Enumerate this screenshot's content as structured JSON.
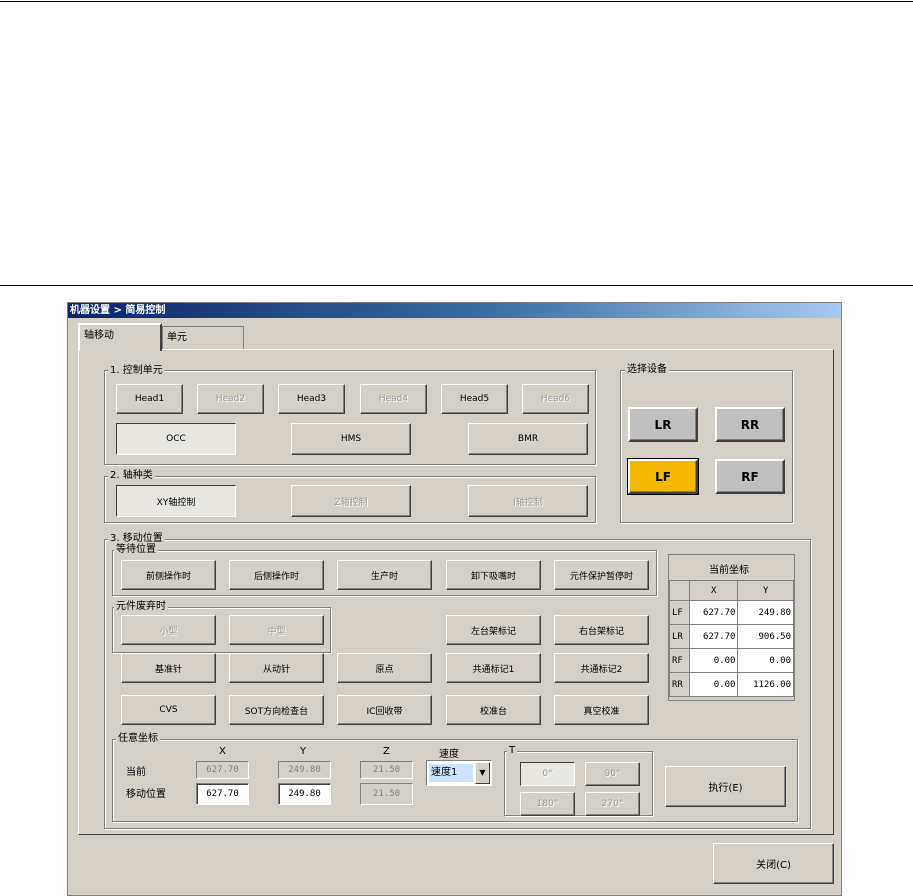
{
  "window": {
    "title": "机器设置 > 简易控制"
  },
  "tabs": [
    {
      "label": "轴移动"
    },
    {
      "label": "单元"
    }
  ],
  "control_unit": {
    "title": "1. 控制单元",
    "heads": [
      "Head1",
      "Head2",
      "Head3",
      "Head4",
      "Head5",
      "Head6"
    ],
    "units": [
      "OCC",
      "HMS",
      "BMR"
    ]
  },
  "axis_type": {
    "title": "2. 轴种类",
    "buttons": [
      "XY轴控制",
      "Z轴控制",
      "I轴控制"
    ]
  },
  "device": {
    "title": "选择设备",
    "buttons": [
      "LR",
      "RR",
      "LF",
      "RF"
    ],
    "selected": "LF",
    "selected_color": "#f5b800"
  },
  "move_position": {
    "title": "3. 移动位置",
    "wait_title": "等待位置",
    "wait_buttons": [
      "前侧操作时",
      "后侧操作时",
      "生产时",
      "卸下吸嘴时",
      "元件保护暂停时"
    ],
    "discard_title": "元件废弃时",
    "discard_buttons": [
      "小型",
      "中型"
    ],
    "mark_buttons": [
      "左台架标记",
      "右台架标记"
    ],
    "row3": [
      "基准针",
      "从动针",
      "原点",
      "共通标记1",
      "共通标记2"
    ],
    "row4": [
      "CVS",
      "SOT方向检查台",
      "IC回收带",
      "校准台",
      "真空校准"
    ]
  },
  "current_coords": {
    "title": "当前坐标",
    "headers": [
      "X",
      "Y"
    ],
    "rows": [
      {
        "label": "LF",
        "x": "627.70",
        "y": "249.80"
      },
      {
        "label": "LR",
        "x": "627.70",
        "y": "906.50"
      },
      {
        "label": "RF",
        "x": "0.00",
        "y": "0.00"
      },
      {
        "label": "RR",
        "x": "0.00",
        "y": "1126.00"
      }
    ]
  },
  "arbitrary": {
    "title": "任意坐标",
    "col_x": "X",
    "col_y": "Y",
    "col_z": "Z",
    "col_speed": "速度",
    "current_label": "当前",
    "move_label": "移动位置",
    "current": {
      "x": "627.70",
      "y": "249.80",
      "z": "21.50"
    },
    "target": {
      "x": "627.70",
      "y": "249.80",
      "z": "21.50"
    },
    "speed_value": "速度1",
    "t_title": "T",
    "t_buttons": [
      "0°",
      "90°",
      "180°",
      "270°"
    ],
    "execute": "执行(E)"
  },
  "footer": {
    "close": "关闭(C)"
  }
}
